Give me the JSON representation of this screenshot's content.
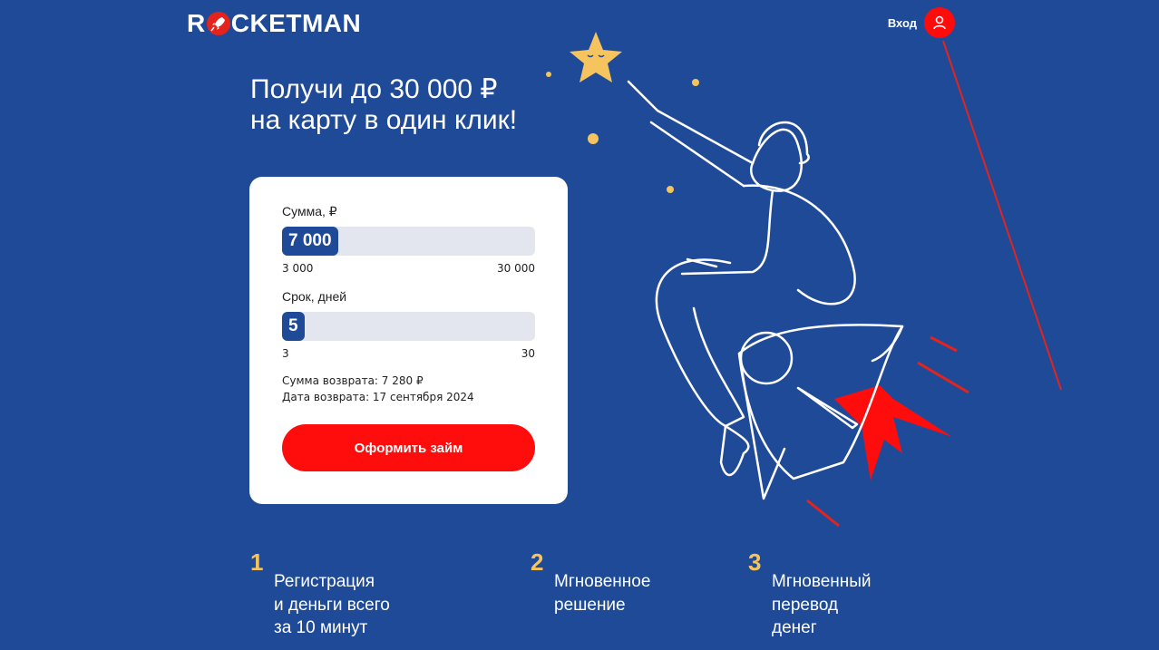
{
  "header": {
    "logo_text": "ROCKETMAN",
    "login_label": "Вход"
  },
  "hero": {
    "headline_line1": "Получи до 30 000 ₽",
    "headline_line2": "на карту в один клик!"
  },
  "calculator": {
    "amount": {
      "label": "Сумма, ₽",
      "value": "7 000",
      "min": "3 000",
      "max": "30 000",
      "level": 0.148
    },
    "term": {
      "label": "Срок, дней",
      "value": "5",
      "min": "3",
      "max": "30",
      "level": 0.074
    },
    "return_sum": "Сумма возврата: 7 280 ₽",
    "return_date": "Дата возврата: 17 сентября 2024",
    "submit_label": "Оформить займ"
  },
  "steps": [
    {
      "number": "1",
      "line1": "Регистрация",
      "line2": "и деньги всего",
      "line3": "за 10 минут"
    },
    {
      "number": "2",
      "line1": "Мгновенное",
      "line2": "решение",
      "line3": ""
    },
    {
      "number": "3",
      "line1": "Мгновенный",
      "line2": "перевод",
      "line3": "денег"
    }
  ],
  "colors": {
    "background": "#1f4a98",
    "accent_red": "#ff0d0d",
    "step_number": "#f5c45e",
    "star": "#f5c45e"
  },
  "icons": {
    "login": "user-icon",
    "logo": "rocket-icon",
    "illustration": "astronaut-rocket-illustration"
  }
}
